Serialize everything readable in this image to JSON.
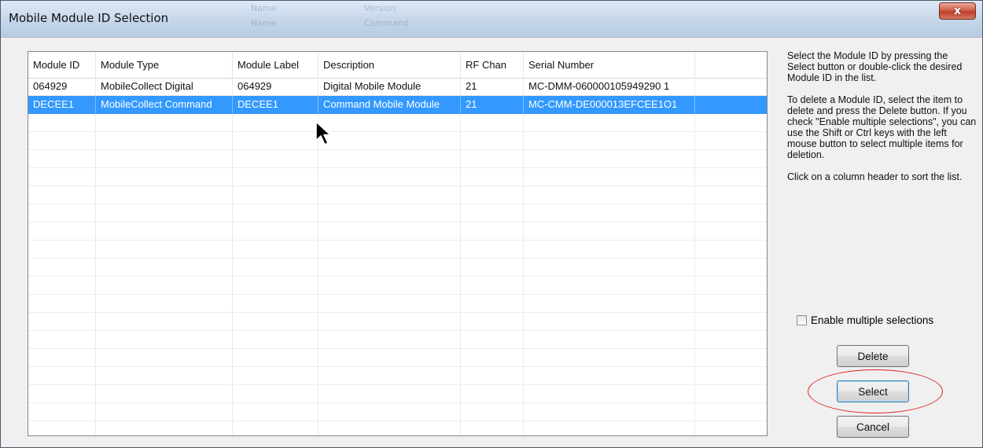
{
  "window": {
    "title": "Mobile Module ID Selection",
    "close_label": "x"
  },
  "ghost_text": [
    "Name",
    "Name",
    "Version",
    "Command"
  ],
  "list": {
    "columns": [
      "Module ID",
      "Module Type",
      "Module Label",
      "Description",
      "RF Chan",
      "Serial Number"
    ],
    "rows": [
      [
        "064929",
        "MobileCollect Digital",
        "064929",
        "Digital Mobile Module",
        "21",
        "MC-DMM-060000105949290 1"
      ],
      [
        "DECEE1",
        "MobileCollect Command",
        "DECEE1",
        "Command Mobile Module",
        "21",
        "MC-CMM-DE000013EFCEE1O1"
      ]
    ],
    "selected_row": 1
  },
  "help": {
    "p1": "Select the Module ID by pressing the Select button or double-click the desired Module ID in the list.",
    "p2": "To delete a Module ID, select the item to delete and press the Delete button.  If you check \"Enable multiple selections\", you can use the Shift or Ctrl keys with the left mouse button to select multiple items for deletion.",
    "p3": "Click on a column header to sort the list."
  },
  "multi_select": {
    "label": "Enable multiple selections",
    "checked": false
  },
  "buttons": {
    "delete": "Delete",
    "select": "Select",
    "cancel": "Cancel"
  },
  "colors": {
    "selection": "#3399ff",
    "highlight_ellipse": "#e02020"
  }
}
